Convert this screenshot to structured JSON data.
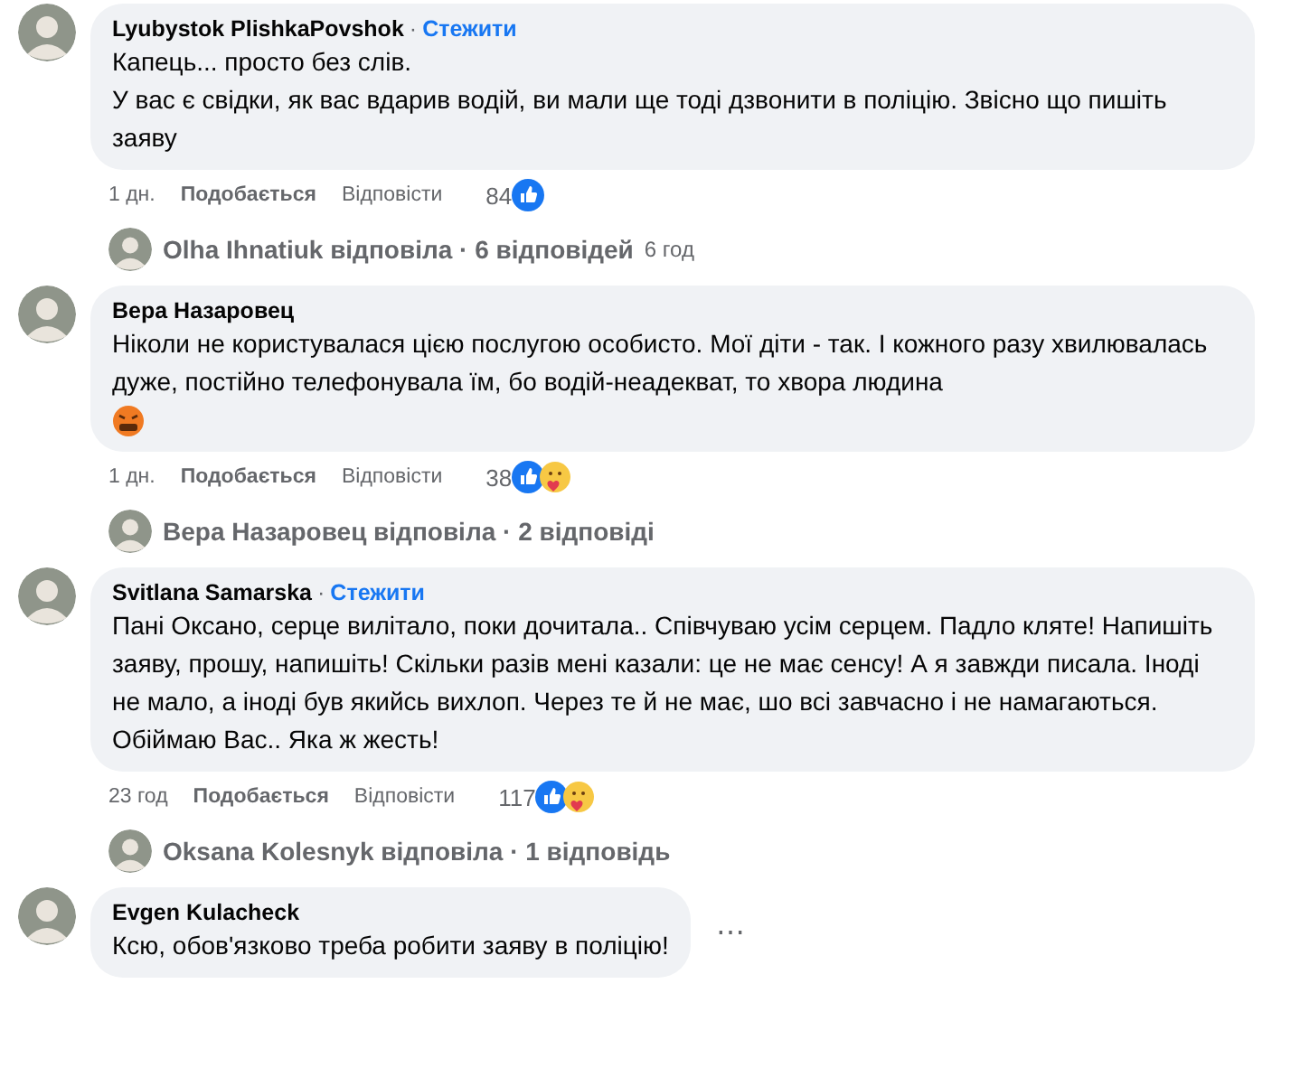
{
  "comments": [
    {
      "author": "Lyubystok PlishkaPovshok",
      "separator": "·",
      "follow": "Стежити",
      "paragraphs": [
        "Капець... просто без слів.",
        "У вас є свідки, як вас вдарив водій, ви мали ще тоді дзвонити в поліцію. Звісно що пишіть заяву"
      ],
      "time": "1 дн.",
      "like": "Подобається",
      "reply": "Відповісти",
      "count": "84",
      "reactions": [
        {
          "kind": "like"
        }
      ],
      "replies": {
        "text": "Olha Ihnatiuk відповіла · 6 відповідей",
        "time": "6 год"
      }
    },
    {
      "author": "Вера Назаровец",
      "paragraphs": [
        "Ніколи не користувалася цією послугою особисто. Мої діти - так. І кожного разу хвилювалась дуже, постійно телефонувала їм, бо водій-неадекват, то хвора людина"
      ],
      "emoji": true,
      "time": "1 дн.",
      "like": "Подобається",
      "reply": "Відповісти",
      "count": "38",
      "reactions": [
        {
          "kind": "like"
        },
        {
          "kind": "care"
        }
      ],
      "replies": {
        "text": "Вера Назаровец відповіла · 2 відповіді"
      }
    },
    {
      "author": "Svitlana Samarska",
      "separator": "·",
      "follow": "Стежити",
      "paragraphs": [
        "Пані Оксано, серце вилітало, поки дочитала.. Співчуваю усім серцем. Падло кляте! Напишіть заяву, прошу, напишіть! Скільки разів мені казали: це не має сенсу! А я завжди писала. Іноді не мало, а іноді був якийсь вихлоп. Через те й не має, шо всі завчасно і не намагаються.",
        "Обіймаю Вас.. Яка ж жесть!"
      ],
      "time": "23 год",
      "like": "Подобається",
      "reply": "Відповісти",
      "count": "117",
      "reactions": [
        {
          "kind": "like"
        },
        {
          "kind": "care"
        }
      ],
      "replies": {
        "text": "Oksana Kolesnyk відповіла · 1 відповідь"
      }
    },
    {
      "author": "Evgen Kulacheck",
      "paragraphs": [
        "Ксю, обов'язково треба робити заяву в поліцію!"
      ],
      "more": "⋯"
    }
  ]
}
